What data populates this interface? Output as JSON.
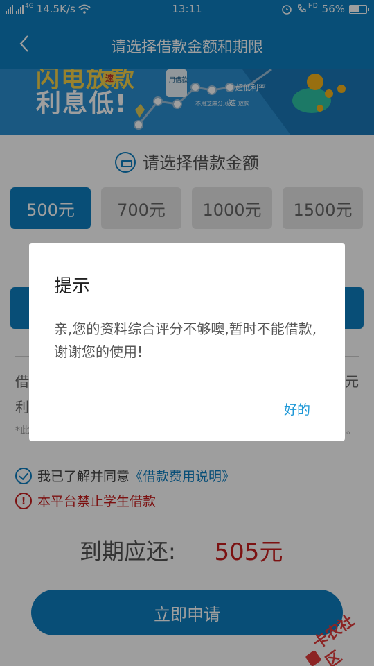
{
  "status_bar": {
    "network_speed": "14.5K/s",
    "network_label": "4G",
    "time": "13:11",
    "hd_label": "HD",
    "battery": "56%",
    "battery_level": 0.56
  },
  "header": {
    "title": "请选择借款金额和期限"
  },
  "banner": {
    "text_top": "闪电放款",
    "text_bottom": "利息低!",
    "badge": "速",
    "label_credit": "用借款",
    "label_rate": "超低利率",
    "label_note_a": "不用芝麻分,极",
    "label_note_b": "速",
    "label_note_c": "放款"
  },
  "amount_section": {
    "title": "请选择借款金额",
    "options": [
      {
        "label": "500元",
        "selected": true
      },
      {
        "label": "700元",
        "selected": false
      },
      {
        "label": "1000元",
        "selected": false
      },
      {
        "label": "1500元",
        "selected": false
      }
    ]
  },
  "info_fragments": {
    "row1_left": "借",
    "row1_right": "元",
    "row2_left": "利",
    "row3_left": "*此",
    "row3_right": "。"
  },
  "agreement": {
    "prefix": "我已了解并同意",
    "link": "《借款费用说明》"
  },
  "warning": {
    "icon": "!",
    "text": "本平台禁止学生借款"
  },
  "due": {
    "label": "到期应还:",
    "value": "505元"
  },
  "apply_button": {
    "label": "立即申请"
  },
  "watermark": {
    "text": "卡农社区"
  },
  "dialog": {
    "title": "提示",
    "message": "亲,您的资料综合评分不够噢,暂时不能借款,谢谢您的使用!",
    "ok_label": "好的"
  },
  "colors": {
    "primary": "#0d7fc1",
    "warning": "#c81e1e",
    "link": "#1e98d7"
  }
}
